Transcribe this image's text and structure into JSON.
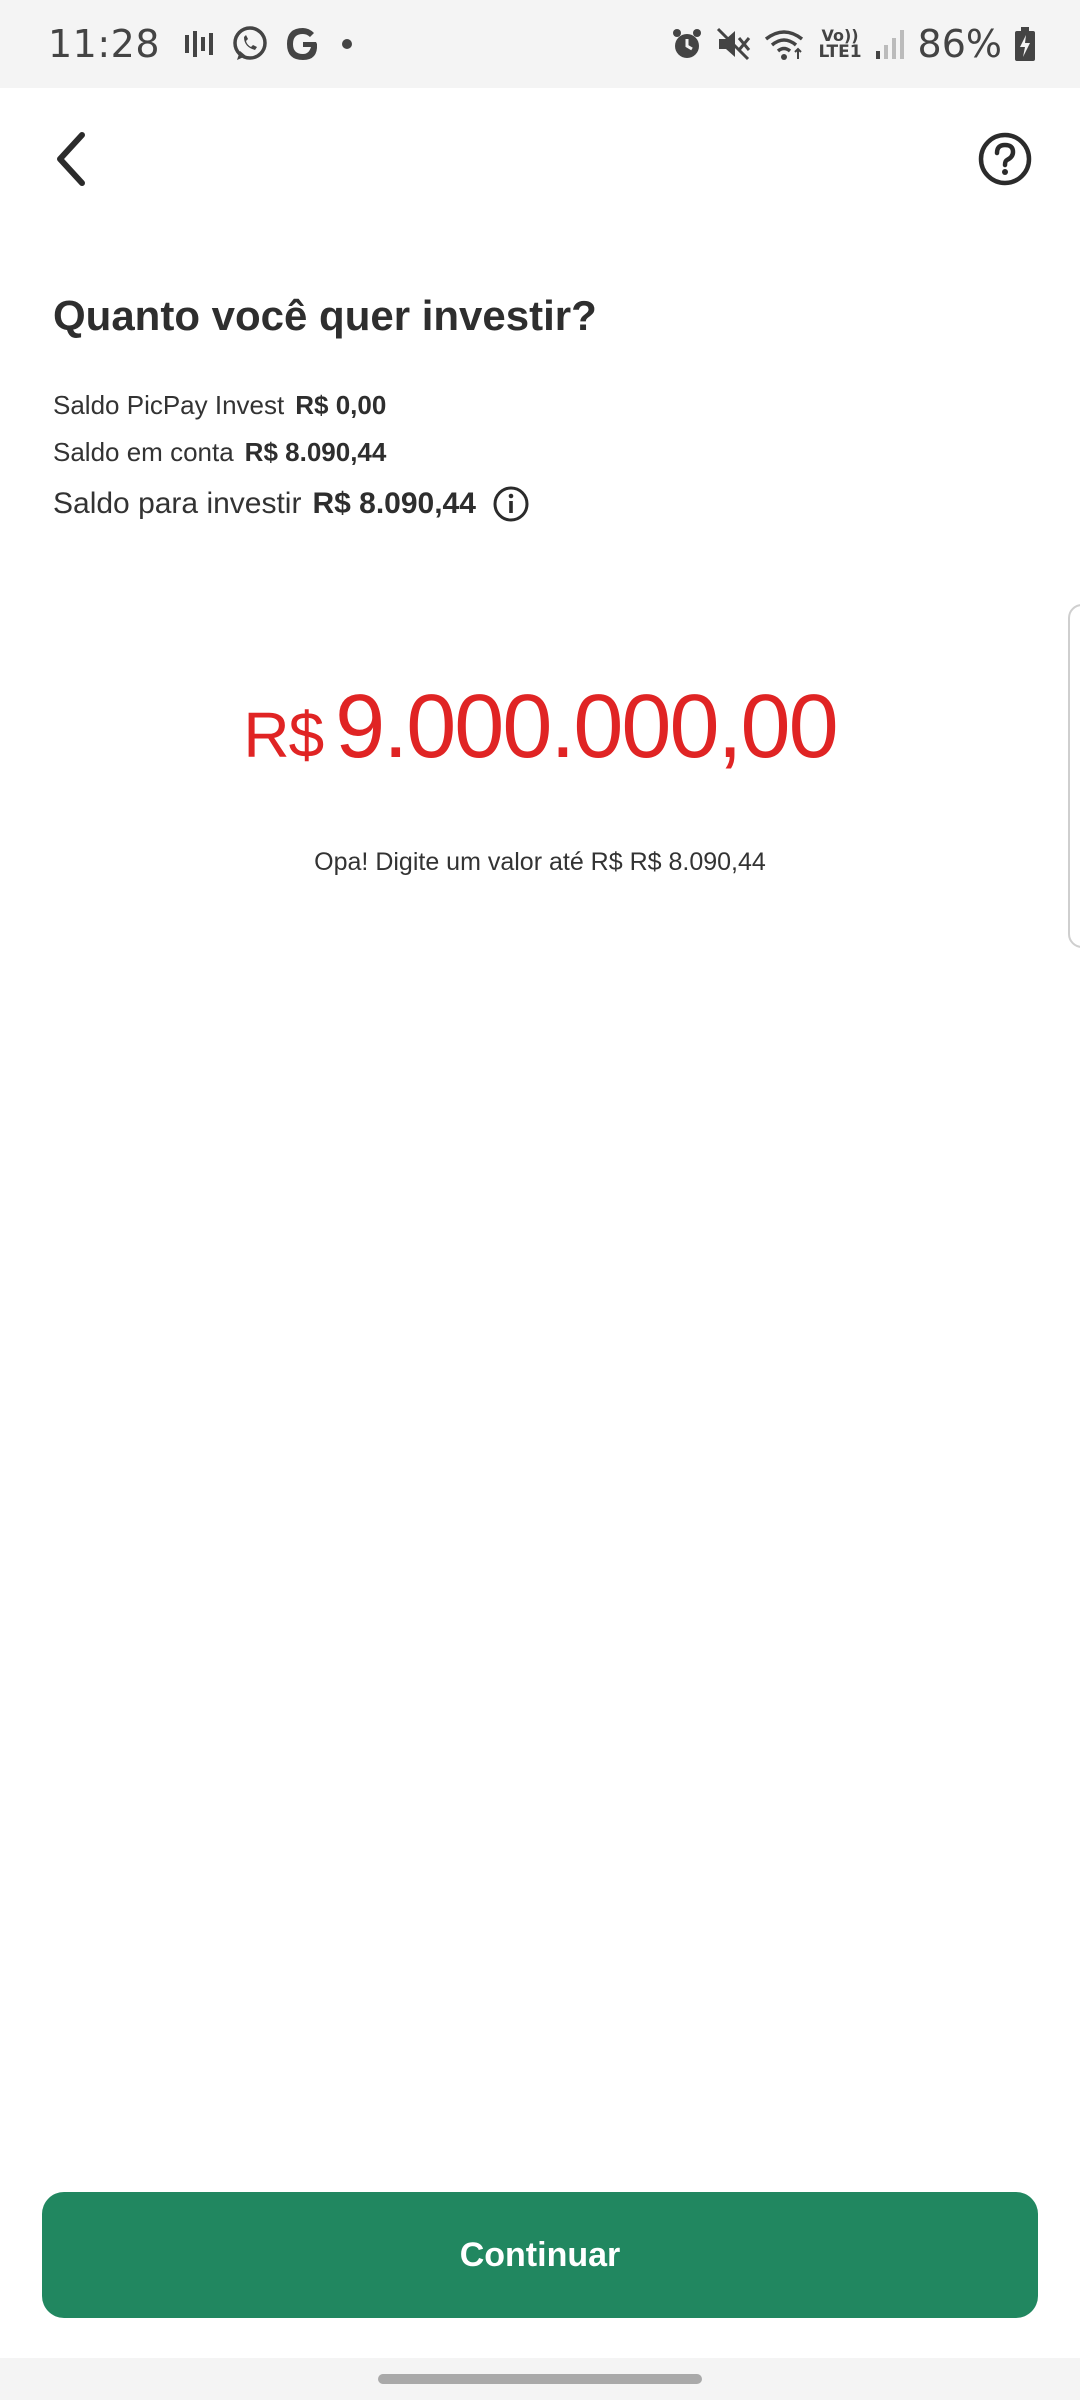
{
  "status_bar": {
    "time": "11:28",
    "battery": "86%",
    "left_icons": [
      "activity-icon",
      "whatsapp-icon",
      "google-icon",
      "dot-icon"
    ],
    "right_icons": [
      "alarm-icon",
      "mute-icon",
      "wifi-icon",
      "volte-icon",
      "signal-icon",
      "battery-icon"
    ],
    "volte_top": "Vo))",
    "volte_bottom": "LTE1"
  },
  "app_bar": {
    "back_icon": "chevron-left-icon",
    "help_icon": "help-circle-icon"
  },
  "page": {
    "title": "Quanto você quer investir?",
    "balances": [
      {
        "label": "Saldo PicPay Invest",
        "value": "R$ 0,00"
      },
      {
        "label": "Saldo em conta",
        "value": "R$ 8.090,44"
      },
      {
        "label": "Saldo para investir",
        "value": "R$ 8.090,44"
      }
    ],
    "info_icon": "info-icon"
  },
  "amount": {
    "currency": "R$",
    "value": "9.000.000,00",
    "color": "#e02424"
  },
  "error_message": "Opa! Digite um valor até R$ R$ 8.090,44",
  "continue_button": {
    "label": "Continuar",
    "color": "#218760"
  }
}
